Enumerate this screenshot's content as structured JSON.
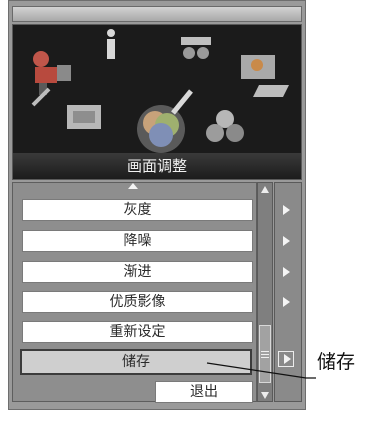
{
  "banner": {
    "caption": "画面调整"
  },
  "menu": {
    "items": [
      {
        "label": "灰度",
        "has_submenu": true,
        "selected": false
      },
      {
        "label": "降噪",
        "has_submenu": true,
        "selected": false
      },
      {
        "label": "渐进",
        "has_submenu": true,
        "selected": false
      },
      {
        "label": "优质影像",
        "has_submenu": true,
        "selected": false
      },
      {
        "label": "重新设定",
        "has_submenu": false,
        "selected": false
      },
      {
        "label": "储存",
        "has_submenu": true,
        "selected": true
      }
    ],
    "exit_label": "退出"
  },
  "callout": {
    "label": "储存"
  },
  "colors": {
    "frame": "#9a9a9a",
    "banner_bg": "#1b1b1b",
    "item_bg": "#ffffff",
    "selected_bg": "#cfcfcf"
  }
}
